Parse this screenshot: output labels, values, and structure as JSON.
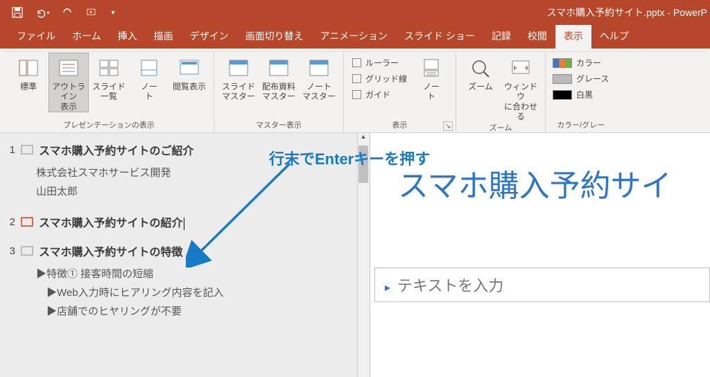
{
  "title": "スマホ購入予約サイト.pptx - PowerP",
  "tabs": [
    "ファイル",
    "ホーム",
    "挿入",
    "描画",
    "デザイン",
    "画面切り替え",
    "アニメーション",
    "スライド ショー",
    "記録",
    "校閲",
    "表示",
    "ヘルプ"
  ],
  "active_tab": 10,
  "ribbon": {
    "g_presentation": {
      "label": "プレゼンテーションの表示",
      "items": [
        "標準",
        "アウトライン\n表示",
        "スライド\n一覧",
        "ノー\nト",
        "閲覧表示"
      ],
      "active": 1
    },
    "g_master": {
      "label": "マスター表示",
      "items": [
        "スライド\nマスター",
        "配布資料\nマスター",
        "ノート\nマスター"
      ]
    },
    "g_show": {
      "label": "表示",
      "checks": [
        "ルーラー",
        "グリッド線",
        "ガイド"
      ],
      "note": "ノー\nト"
    },
    "g_zoom": {
      "label": "ズーム",
      "items": [
        "ズーム",
        "ウィンドウ\nに合わせる"
      ]
    },
    "g_color": {
      "label": "カラー/グレー",
      "rows": [
        "カラー",
        "グレース",
        "白黒"
      ]
    }
  },
  "outline": {
    "slides": [
      {
        "num": "1",
        "title": "スマホ購入予約サイトのご紹介",
        "body": [
          "株式会社スマホサービス開発",
          "山田太郎"
        ],
        "sel": false
      },
      {
        "num": "2",
        "title": "スマホ購入予約サイトの紹介",
        "body": [],
        "sel": true,
        "cursor": true
      },
      {
        "num": "3",
        "title": "スマホ購入予約サイトの特徴",
        "body": [
          "▶特徴① 接客時間の短縮",
          "　▶Web入力時にヒアリング内容を記入",
          "　▶店舗でのヒヤリングが不要"
        ],
        "sel": false
      }
    ]
  },
  "preview": {
    "title": "スマホ購入予約サイ",
    "body": "テキストを入力"
  },
  "annotation": "行末でEnterキーを押す"
}
